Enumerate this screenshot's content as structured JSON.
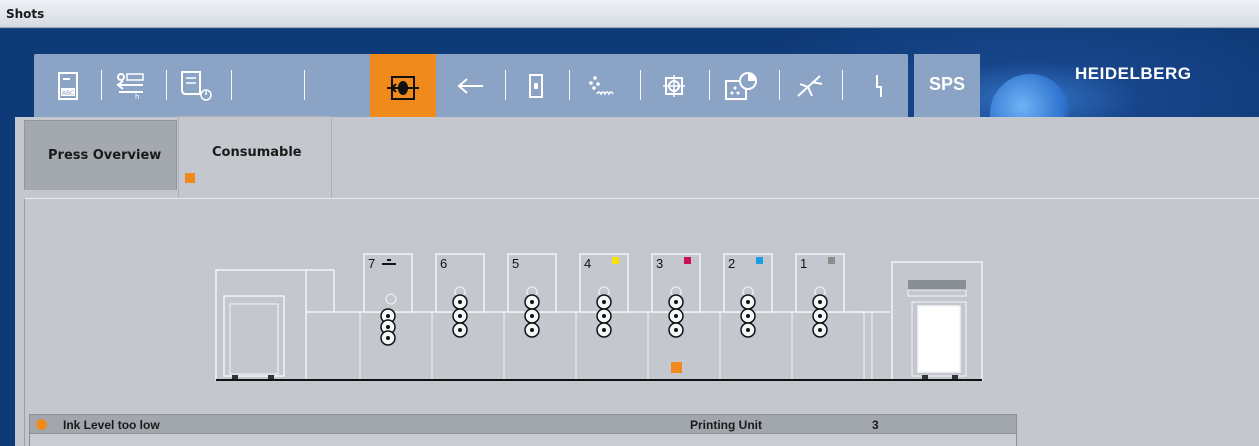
{
  "window": {
    "title": "Shots"
  },
  "brand": {
    "logo_text": "HEIDELBERG",
    "sps_label": "SPS"
  },
  "toolbar": {
    "buttons": [
      {
        "icon": "job-abc-icon"
      },
      {
        "icon": "transfer-icon"
      },
      {
        "icon": "document-clock-icon"
      },
      {
        "icon": "blank-icon"
      },
      {
        "icon": "press-unit-icon",
        "active": true
      },
      {
        "icon": "arrow-left-icon"
      },
      {
        "icon": "door-icon"
      },
      {
        "icon": "dots-wave-icon"
      },
      {
        "icon": "crosshair-icon"
      },
      {
        "icon": "pie-chart-icon"
      },
      {
        "icon": "diagonal-arrow-icon"
      },
      {
        "icon": "lightning-icon"
      }
    ]
  },
  "tabs": {
    "press_overview": "Press Overview",
    "consumable": "Consumable"
  },
  "press": {
    "units": [
      {
        "label": "7",
        "swatch": "none"
      },
      {
        "label": "6",
        "swatch": "none"
      },
      {
        "label": "5",
        "swatch": "none"
      },
      {
        "label": "4",
        "swatch": "#f5e400"
      },
      {
        "label": "3",
        "swatch": "#c8105a"
      },
      {
        "label": "2",
        "swatch": "#1aa0e0"
      },
      {
        "label": "1",
        "swatch": "#8c8c8c"
      }
    ],
    "alert_unit": "3"
  },
  "status": {
    "message": "Ink Level too low",
    "field_label": "Printing Unit",
    "field_value": "3"
  },
  "colors": {
    "accent": "#f08a1c",
    "toolbar": "#8ba4c6",
    "panel": "#c4c8ce"
  }
}
